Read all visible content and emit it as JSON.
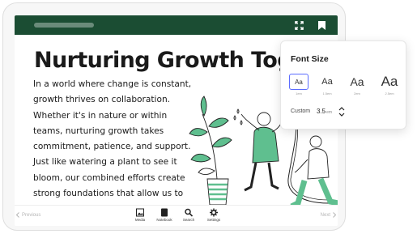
{
  "article": {
    "headline": "Nurturing Growth Together",
    "body": "In a world where change is constant, growth thrives on collaboration. Whether it's in nature or within teams, nurturing growth takes commitment, patience, and support. Just like watering a plant to see it bloom, our combined efforts create strong foundations that allow us to reach new heights."
  },
  "toolbar": {
    "icons": [
      "expand-icon",
      "bookmark-icon"
    ]
  },
  "bottom_nav": {
    "previous_label": "Previous",
    "next_label": "Next",
    "tools": [
      {
        "label": "Media",
        "icon": "media-icon"
      },
      {
        "label": "Notebook",
        "icon": "notebook-icon"
      },
      {
        "label": "Search",
        "icon": "search-icon"
      },
      {
        "label": "Settings",
        "icon": "gear-icon"
      }
    ]
  },
  "font_size_panel": {
    "title": "Font Size",
    "options": [
      {
        "sample": "Aa",
        "label": "1em",
        "selected": true
      },
      {
        "sample": "Aa",
        "label": "1.5em",
        "selected": false
      },
      {
        "sample": "Aa",
        "label": "2em",
        "selected": false
      },
      {
        "sample": "Aa",
        "label": "2.5em",
        "selected": false
      }
    ],
    "custom_label": "Custom",
    "custom_value": "3.5",
    "custom_unit": "em"
  },
  "colors": {
    "topbar": "#1b4d33",
    "accent_green": "#5fbf8f",
    "selection": "#5b6cff"
  }
}
